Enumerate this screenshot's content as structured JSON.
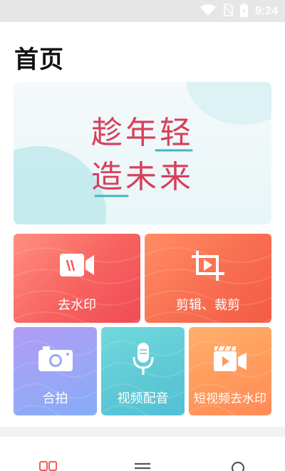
{
  "status_bar": {
    "time": "9:24",
    "icons": [
      "wifi-icon",
      "no-sim-icon",
      "battery-charging-icon"
    ]
  },
  "page": {
    "title": "首页"
  },
  "banner": {
    "slogan_line1": "趁年轻",
    "slogan_line2": "造未来",
    "colors": {
      "primary": "#d83f5a",
      "secondary": "#3fb8c0"
    }
  },
  "features": [
    {
      "label": "去水印",
      "icon": "video-camera-icon",
      "color": "#f45a5a"
    },
    {
      "label": "剪辑、裁剪",
      "icon": "crop-video-icon",
      "color": "#f86a4c"
    },
    {
      "label": "合拍",
      "icon": "camera-icon",
      "color": "#9aa6f6"
    },
    {
      "label": "视频配音",
      "icon": "microphone-icon",
      "color": "#5fcad5"
    },
    {
      "label": "短视频去水印",
      "icon": "clapperboard-icon",
      "color": "#ff9a5c"
    }
  ],
  "bottom_nav": {
    "items": [
      {
        "icon": "home-grid-icon",
        "active": true,
        "color": "#f45a5a"
      },
      {
        "icon": "list-icon",
        "active": false
      },
      {
        "icon": "profile-icon",
        "active": false
      }
    ]
  }
}
